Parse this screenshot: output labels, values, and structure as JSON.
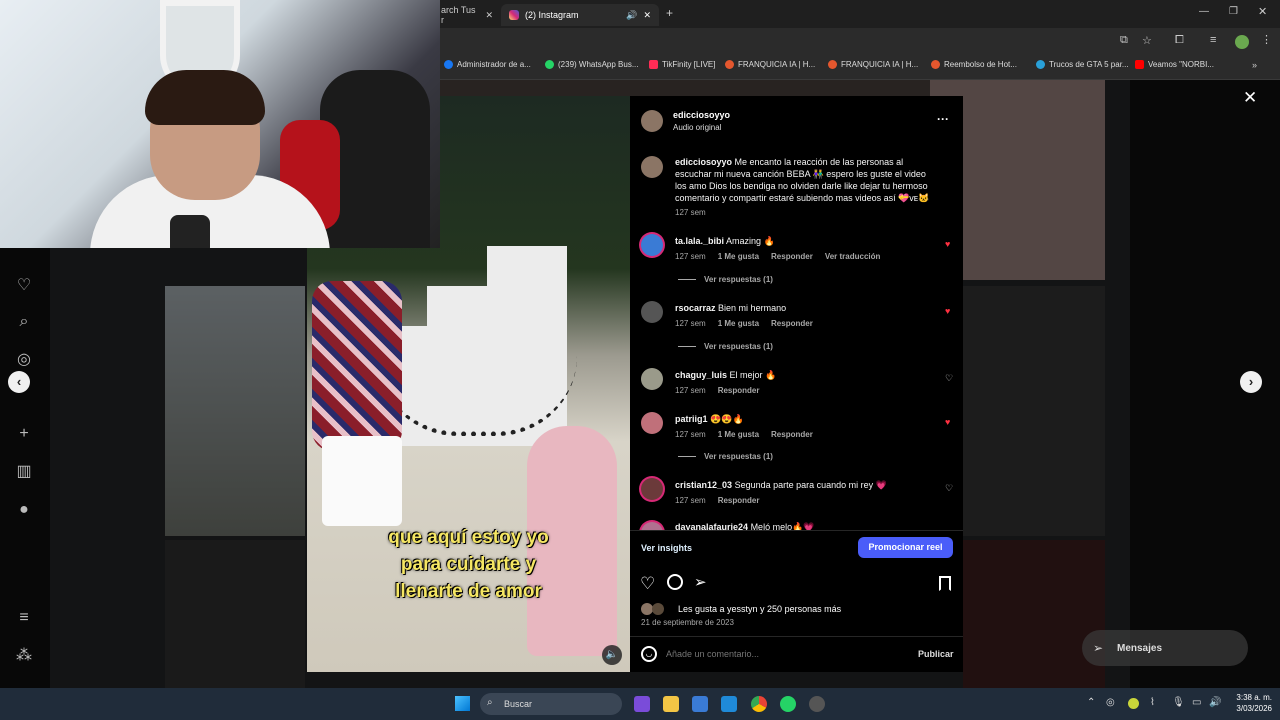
{
  "browser": {
    "tabs": [
      {
        "label": "arch Tus r"
      },
      {
        "label": "(2) Instagram"
      }
    ],
    "bookmarks": [
      {
        "label": "Administrador de a...",
        "color": "#1877f2"
      },
      {
        "label": "(239) WhatsApp Bus...",
        "color": "#25d366"
      },
      {
        "label": "TikFinity [LIVE]",
        "color": "#fe2c55"
      },
      {
        "label": "FRANQUICIA IA | H...",
        "color": "#e4572e"
      },
      {
        "label": "FRANQUICIA IA | H...",
        "color": "#e4572e"
      },
      {
        "label": "Reembolso de Hot...",
        "color": "#e4572e"
      },
      {
        "label": "Trucos de GTA 5 par...",
        "color": "#29a0d8"
      },
      {
        "label": "Veamos \"NORBI...",
        "color": "#ff0000"
      }
    ]
  },
  "post": {
    "username": "edicciosoyyo",
    "audio": "Audio original",
    "caption_user": "edicciosoyyo",
    "caption_text": "Me encanto la reacción de las personas al escuchar mi nueva canción BEBA 👫 espero les guste el video los amo Dios los bendiga no olviden darle like dejar tu hermoso comentario y compartir estaré subiendo mas videos así 💝ᴠᴇ🐱",
    "caption_time": "127 sem",
    "video_caption": [
      "que aquí estoy yo",
      "para cuidarte y",
      "llenarte de amor"
    ],
    "view_insights": "Ver insights",
    "promote": "Promocionar reel",
    "likes_text": "Les gusta a yesstyn y 250 personas más",
    "date": "21 de septiembre de 2023",
    "comment_placeholder": "Añade un comentario...",
    "publish": "Publicar"
  },
  "comments": [
    {
      "user": "ta.lala._bibi",
      "text": "Amazing 🔥",
      "time": "127 sem",
      "likes": "1 Me gusta",
      "reply": "Responder",
      "translate": "Ver traducción",
      "replies": "Ver respuestas (1)",
      "liked": true
    },
    {
      "user": "rsocarraz",
      "text": "Bien mi hermano",
      "time": "127 sem",
      "likes": "1 Me gusta",
      "reply": "Responder",
      "replies": "Ver respuestas (1)",
      "liked": true
    },
    {
      "user": "chaguy_luis",
      "text": "El mejor 🔥",
      "time": "127 sem",
      "reply": "Responder",
      "liked": false
    },
    {
      "user": "patriig1",
      "text": "😍😍🔥",
      "time": "127 sem",
      "likes": "1 Me gusta",
      "reply": "Responder",
      "replies": "Ver respuestas (1)",
      "liked": true
    },
    {
      "user": "cristian12_03",
      "text": "Segunda parte para cuando mi rey 💗",
      "time": "127 sem",
      "reply": "Responder",
      "liked": false
    },
    {
      "user": "dayanalafaurie24",
      "text": "Meló melo🔥💗"
    }
  ],
  "messages": {
    "label": "Mensajes"
  },
  "taskbar": {
    "search": "Buscar",
    "time": "3:38 a. m.",
    "date": "3/03/2026"
  }
}
